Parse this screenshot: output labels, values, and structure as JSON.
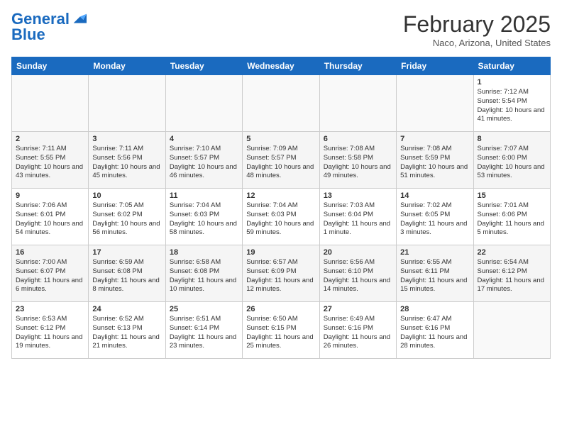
{
  "header": {
    "logo_line1": "General",
    "logo_line2": "Blue",
    "month": "February 2025",
    "location": "Naco, Arizona, United States"
  },
  "weekdays": [
    "Sunday",
    "Monday",
    "Tuesday",
    "Wednesday",
    "Thursday",
    "Friday",
    "Saturday"
  ],
  "weeks": [
    [
      {
        "day": "",
        "info": ""
      },
      {
        "day": "",
        "info": ""
      },
      {
        "day": "",
        "info": ""
      },
      {
        "day": "",
        "info": ""
      },
      {
        "day": "",
        "info": ""
      },
      {
        "day": "",
        "info": ""
      },
      {
        "day": "1",
        "info": "Sunrise: 7:12 AM\nSunset: 5:54 PM\nDaylight: 10 hours and 41 minutes."
      }
    ],
    [
      {
        "day": "2",
        "info": "Sunrise: 7:11 AM\nSunset: 5:55 PM\nDaylight: 10 hours and 43 minutes."
      },
      {
        "day": "3",
        "info": "Sunrise: 7:11 AM\nSunset: 5:56 PM\nDaylight: 10 hours and 45 minutes."
      },
      {
        "day": "4",
        "info": "Sunrise: 7:10 AM\nSunset: 5:57 PM\nDaylight: 10 hours and 46 minutes."
      },
      {
        "day": "5",
        "info": "Sunrise: 7:09 AM\nSunset: 5:57 PM\nDaylight: 10 hours and 48 minutes."
      },
      {
        "day": "6",
        "info": "Sunrise: 7:08 AM\nSunset: 5:58 PM\nDaylight: 10 hours and 49 minutes."
      },
      {
        "day": "7",
        "info": "Sunrise: 7:08 AM\nSunset: 5:59 PM\nDaylight: 10 hours and 51 minutes."
      },
      {
        "day": "8",
        "info": "Sunrise: 7:07 AM\nSunset: 6:00 PM\nDaylight: 10 hours and 53 minutes."
      }
    ],
    [
      {
        "day": "9",
        "info": "Sunrise: 7:06 AM\nSunset: 6:01 PM\nDaylight: 10 hours and 54 minutes."
      },
      {
        "day": "10",
        "info": "Sunrise: 7:05 AM\nSunset: 6:02 PM\nDaylight: 10 hours and 56 minutes."
      },
      {
        "day": "11",
        "info": "Sunrise: 7:04 AM\nSunset: 6:03 PM\nDaylight: 10 hours and 58 minutes."
      },
      {
        "day": "12",
        "info": "Sunrise: 7:04 AM\nSunset: 6:03 PM\nDaylight: 10 hours and 59 minutes."
      },
      {
        "day": "13",
        "info": "Sunrise: 7:03 AM\nSunset: 6:04 PM\nDaylight: 11 hours and 1 minute."
      },
      {
        "day": "14",
        "info": "Sunrise: 7:02 AM\nSunset: 6:05 PM\nDaylight: 11 hours and 3 minutes."
      },
      {
        "day": "15",
        "info": "Sunrise: 7:01 AM\nSunset: 6:06 PM\nDaylight: 11 hours and 5 minutes."
      }
    ],
    [
      {
        "day": "16",
        "info": "Sunrise: 7:00 AM\nSunset: 6:07 PM\nDaylight: 11 hours and 6 minutes."
      },
      {
        "day": "17",
        "info": "Sunrise: 6:59 AM\nSunset: 6:08 PM\nDaylight: 11 hours and 8 minutes."
      },
      {
        "day": "18",
        "info": "Sunrise: 6:58 AM\nSunset: 6:08 PM\nDaylight: 11 hours and 10 minutes."
      },
      {
        "day": "19",
        "info": "Sunrise: 6:57 AM\nSunset: 6:09 PM\nDaylight: 11 hours and 12 minutes."
      },
      {
        "day": "20",
        "info": "Sunrise: 6:56 AM\nSunset: 6:10 PM\nDaylight: 11 hours and 14 minutes."
      },
      {
        "day": "21",
        "info": "Sunrise: 6:55 AM\nSunset: 6:11 PM\nDaylight: 11 hours and 15 minutes."
      },
      {
        "day": "22",
        "info": "Sunrise: 6:54 AM\nSunset: 6:12 PM\nDaylight: 11 hours and 17 minutes."
      }
    ],
    [
      {
        "day": "23",
        "info": "Sunrise: 6:53 AM\nSunset: 6:12 PM\nDaylight: 11 hours and 19 minutes."
      },
      {
        "day": "24",
        "info": "Sunrise: 6:52 AM\nSunset: 6:13 PM\nDaylight: 11 hours and 21 minutes."
      },
      {
        "day": "25",
        "info": "Sunrise: 6:51 AM\nSunset: 6:14 PM\nDaylight: 11 hours and 23 minutes."
      },
      {
        "day": "26",
        "info": "Sunrise: 6:50 AM\nSunset: 6:15 PM\nDaylight: 11 hours and 25 minutes."
      },
      {
        "day": "27",
        "info": "Sunrise: 6:49 AM\nSunset: 6:16 PM\nDaylight: 11 hours and 26 minutes."
      },
      {
        "day": "28",
        "info": "Sunrise: 6:47 AM\nSunset: 6:16 PM\nDaylight: 11 hours and 28 minutes."
      },
      {
        "day": "",
        "info": ""
      }
    ]
  ]
}
